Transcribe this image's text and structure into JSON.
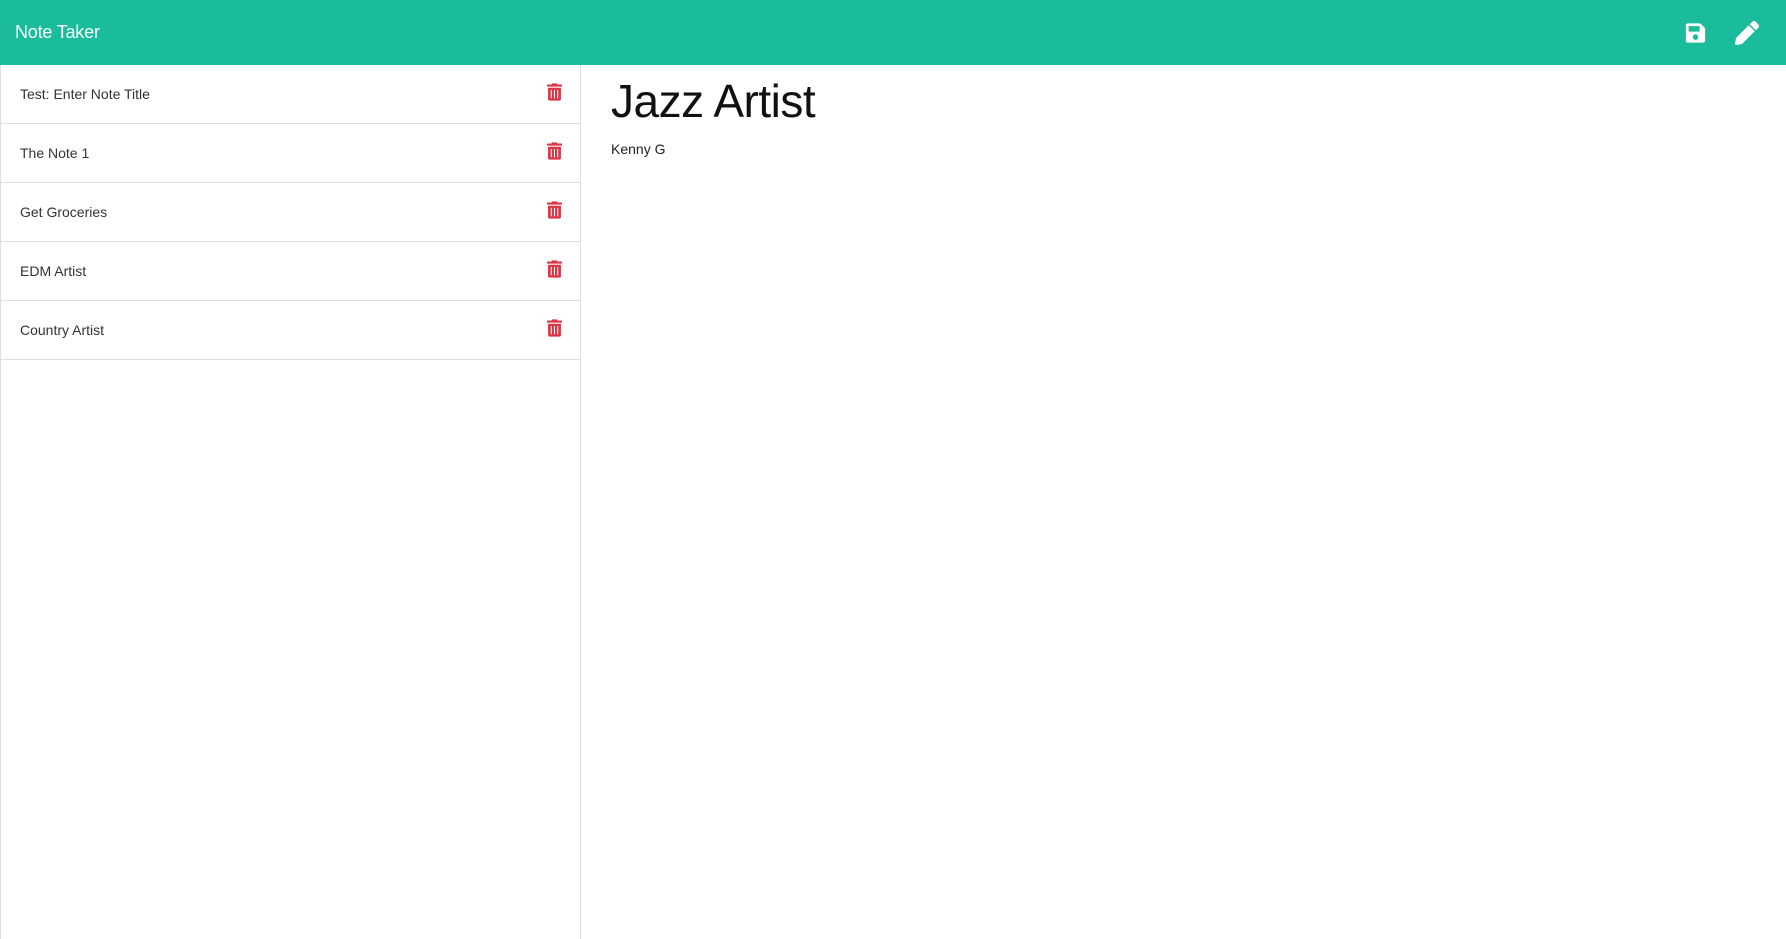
{
  "app": {
    "title": "Note Taker"
  },
  "toolbar": {
    "save_icon": "floppy-disk-icon",
    "new_note_icon": "pencil-icon"
  },
  "colors": {
    "accent": "#1abc9c",
    "delete": "#dc3545"
  },
  "notes": [
    {
      "title": "Test: Enter Note Title"
    },
    {
      "title": "The Note 1"
    },
    {
      "title": "Get Groceries"
    },
    {
      "title": "EDM Artist"
    },
    {
      "title": "Country Artist"
    }
  ],
  "active_note": {
    "title": "Jazz Artist",
    "text": "Kenny G"
  }
}
